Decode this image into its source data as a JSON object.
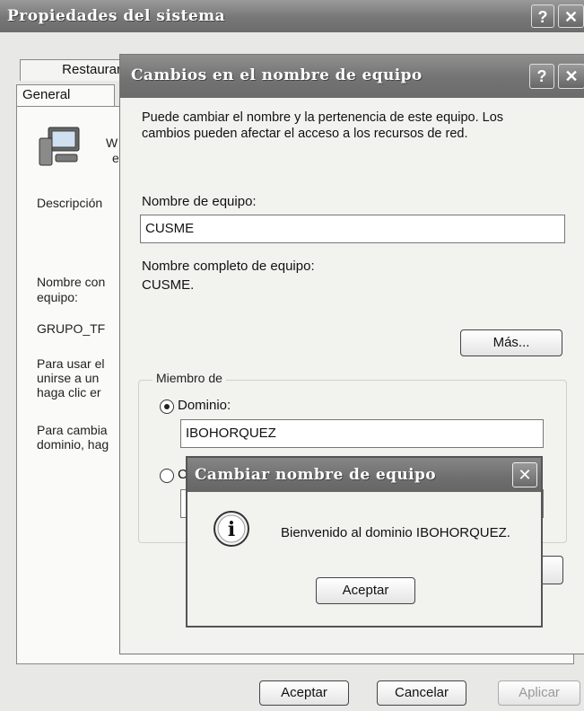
{
  "outer_window": {
    "title": "Propiedades del sistema",
    "help_button": "?",
    "close_button": "✕",
    "tabs": [
      "Restaurar",
      "General"
    ],
    "text_lines": [
      "W",
      "er",
      "Descripción",
      "Nombre con",
      "equipo:",
      "GRUPO_TF",
      "Para usar el",
      "unirse a un",
      "haga clic er",
      "Para cambia",
      "dominio, hag"
    ],
    "buttons": {
      "ok": "Aceptar",
      "cancel": "Cancelar",
      "apply": "Aplicar"
    }
  },
  "rename_dialog": {
    "title": "Cambios en el nombre de equipo",
    "help_button": "?",
    "close_button": "✕",
    "intro_line1": "Puede cambiar el nombre y la pertenencia de este equipo. Los",
    "intro_line2": "cambios pueden afectar el acceso a los recursos de red.",
    "computer_name_label": "Nombre de equipo:",
    "computer_name_value": "CUSME",
    "full_name_label": "Nombre completo de equipo:",
    "full_name_value": "CUSME.",
    "more_button": "Más...",
    "member_of_label": "Miembro de",
    "domain_radio_label": "Dominio:",
    "domain_value": "IBOHORQUEZ",
    "workgroup_radio_partial": "C",
    "domain_selected": true
  },
  "message_box": {
    "title": "Cambiar nombre de equipo",
    "close_button": "✕",
    "message": "Bienvenido al dominio IBOHORQUEZ.",
    "ok_button": "Aceptar",
    "icon": "info-icon"
  }
}
